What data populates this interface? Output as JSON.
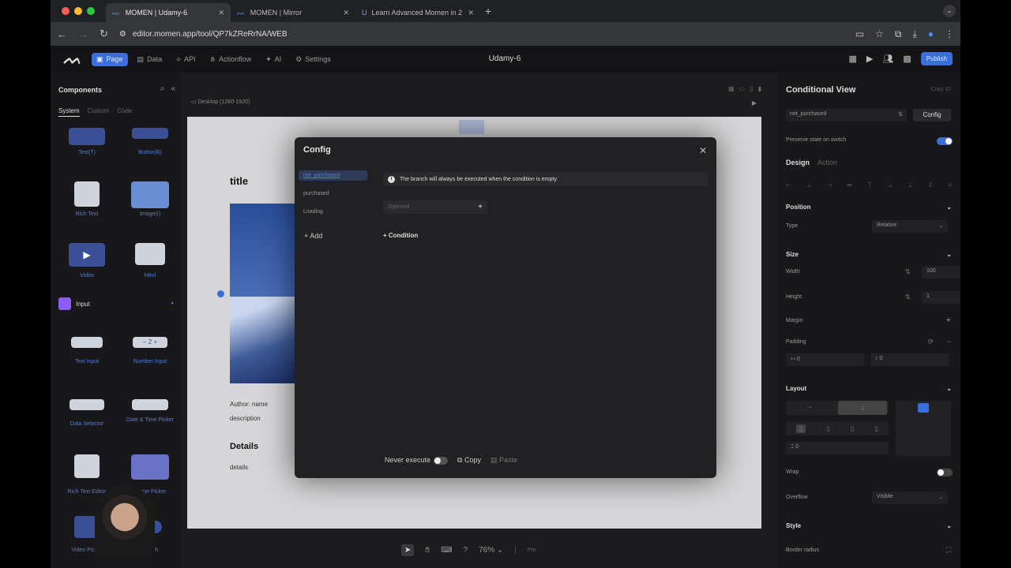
{
  "browser": {
    "tabs": [
      {
        "title": "MOMEN | Udamy-6",
        "active": true
      },
      {
        "title": "MOMEN | Mirror",
        "active": false
      },
      {
        "title": "Learn Advanced Momen in 2",
        "active": false
      }
    ],
    "url": "editor.momen.app/tool/QP7kZReRrNA/WEB"
  },
  "app": {
    "nav": [
      {
        "label": "Page",
        "icon": "page-icon",
        "active": true
      },
      {
        "label": "Data",
        "icon": "data-icon",
        "active": false
      },
      {
        "label": "API",
        "icon": "api-icon",
        "active": false
      },
      {
        "label": "Actionflow",
        "icon": "actionflow-icon",
        "active": false
      },
      {
        "label": "AI",
        "icon": "ai-icon",
        "active": false
      },
      {
        "label": "Settings",
        "icon": "gear-icon",
        "active": false
      }
    ],
    "project_title": "Udamy-6",
    "publish_label": "Publish"
  },
  "components_panel": {
    "title": "Components",
    "tabs": [
      "System",
      "Custom",
      "Code"
    ],
    "items": [
      {
        "label": "Text(T)"
      },
      {
        "label": "Button(B)"
      },
      {
        "label": "Rich Text"
      },
      {
        "label": "Image(I)"
      },
      {
        "label": "Video"
      },
      {
        "label": "Html"
      },
      {
        "label": "Text Input"
      },
      {
        "label": "Number Input"
      },
      {
        "label": "Data Selector"
      },
      {
        "label": "Date & Time Picker"
      },
      {
        "label": "Rich Text Editor"
      },
      {
        "label": "Image Picker"
      },
      {
        "label": "Video Picker"
      },
      {
        "label": "Switch"
      }
    ],
    "section_input": "Input"
  },
  "canvas": {
    "device_label": "Desktop (1280-1920)",
    "card_title": "title",
    "author": "Author: name",
    "description": "description",
    "details_heading": "Details",
    "details_text": "details",
    "zoom": "76%",
    "mode": "Pre"
  },
  "config_modal": {
    "title": "Config",
    "branches": [
      "not_purchased",
      "purchased",
      "Loading"
    ],
    "add_label": "Add",
    "info_text": "The branch will always be executed when the condition is empty.",
    "operand_placeholder": "Operand",
    "condition_label": "Condition",
    "never_execute_label": "Never execute",
    "copy_label": "Copy",
    "paste_label": "Paste"
  },
  "inspector": {
    "title": "Conditional View",
    "copy_id_label": "Copy ID",
    "selected_branch": "not_purchased",
    "config_button": "Config",
    "preserve_state_label": "Preserve state on switch",
    "tabs": [
      "Design",
      "Action"
    ],
    "position": {
      "heading": "Position",
      "type_label": "Type",
      "type_value": "Relative"
    },
    "size": {
      "heading": "Size",
      "width_label": "Width",
      "width_value": "100",
      "width_unit": "%",
      "height_label": "Height",
      "height_value": "1",
      "height_unit": "fr"
    },
    "margin_label": "Margin",
    "padding": {
      "label": "Padding",
      "h": "0",
      "v": "0"
    },
    "layout": {
      "heading": "Layout",
      "gap": "0"
    },
    "wrap_label": "Wrap",
    "overflow": {
      "label": "Overflow",
      "value": "Visible"
    },
    "style_heading": "Style",
    "border_radius_label": "Border radius"
  },
  "colors": {
    "accent": "#3b6ed8",
    "link": "#5b7bcf"
  }
}
